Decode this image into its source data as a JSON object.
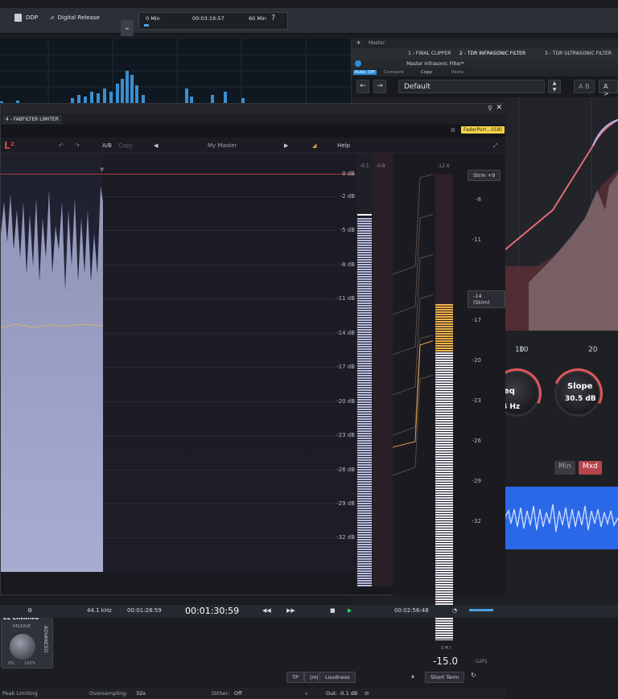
{
  "toolbar": {
    "ddp": "DDP",
    "digital_release": "Digital Release",
    "time_min": "0 Min",
    "time_current": "00:03:19:57",
    "time_max": "60 Min",
    "help": "?"
  },
  "tdr": {
    "master_label": "Master",
    "tabs": [
      "1 - FINAL CLIPPER",
      "2 - TDR INFRASONIC FILTER",
      "3 - TDR ULTRASONIC FILTER"
    ],
    "preset_name": "Master Infrasonic Filter*",
    "auto_off": "Auto: Off",
    "compare": "Compare",
    "copy": "Copy",
    "paste": "Paste",
    "preset_field": "Default",
    "ab_label": "A B",
    "ab_copy": "A > B",
    "freq_ticks": [
      "10",
      "20"
    ],
    "freq_knob_label": "eq",
    "freq_knob_value": "4 Hz",
    "slope_label": "Slope",
    "slope_value": "30.5 dB",
    "min_btn": "Min",
    "mxd_btn": "Mxd"
  },
  "prol2": {
    "tab": "4 - FABFILTER LIMITER",
    "fader_badge": "FaderPort...018)",
    "logo": "L²",
    "ab": "A/B",
    "copy": "Copy",
    "preset": "My Master",
    "help": "Help",
    "db_scale": [
      "0 dB",
      "-2 dB",
      "-5 dB",
      "-8 dB",
      "-11 dB",
      "-14 dB",
      "-17 dB",
      "-20 dB",
      "-23 dB",
      "-26 dB",
      "-29 dB",
      "-32 dB"
    ],
    "peak_a": "-0.1",
    "peak_b": "-0.8",
    "lufs_top": "-12.6",
    "strm_btn": "Strm +9",
    "strm_marker": "-14 (Strm)",
    "lufs_scale": [
      "-8",
      "-11",
      "-14",
      "-17",
      "-20",
      "-23",
      "-26",
      "-29",
      "-32"
    ],
    "meter_letters": "S    M  I",
    "lufs_value": "-15.0",
    "lufs_unit": "LUFS",
    "short_term": "Short Term",
    "tp": "TP",
    "loudness": "Loudness",
    "adv_title": "EL LINKING",
    "adv_release": "RELEASE",
    "adv_side": "ADVANCED",
    "adv_pct0": "0%",
    "adv_pct100": "100%",
    "status_left": "Peak Limiting",
    "oversampling_label": "Oversampling:",
    "oversampling_value": "32x",
    "dither_label": "Dither:",
    "dither_value": "Off",
    "out_label": "Out: -0.1 dB"
  },
  "transport": {
    "rate": "44.1 kHz",
    "time1": "00:01:28:59",
    "time_main": "00:01:30:59",
    "time_right": "00:02:56:48"
  }
}
